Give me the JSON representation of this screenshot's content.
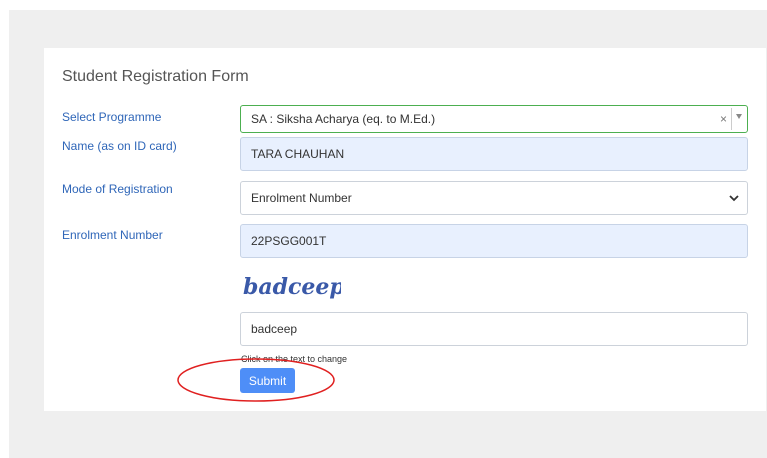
{
  "form": {
    "title": "Student Registration Form",
    "programme": {
      "label": "Select Programme",
      "value": "SA : Siksha Acharya (eq. to M.Ed.)",
      "clear_glyph": "×"
    },
    "name": {
      "label": "Name (as on ID card)",
      "value": "TARA CHAUHAN"
    },
    "mode": {
      "label": "Mode of Registration",
      "value": "Enrolment Number"
    },
    "enrolment": {
      "label": "Enrolment Number",
      "value": "22PSGG001T"
    },
    "captcha": {
      "image_text": "badceep",
      "input_value": "badceep",
      "hint": "Click on the text to change"
    },
    "submit_label": "Submit"
  },
  "colors": {
    "label": "#2f66b8",
    "button": "#4e8ef7",
    "readonly_bg": "#e8f0fe",
    "select_focus_border": "#4caf50",
    "annotation": "#e02020"
  }
}
